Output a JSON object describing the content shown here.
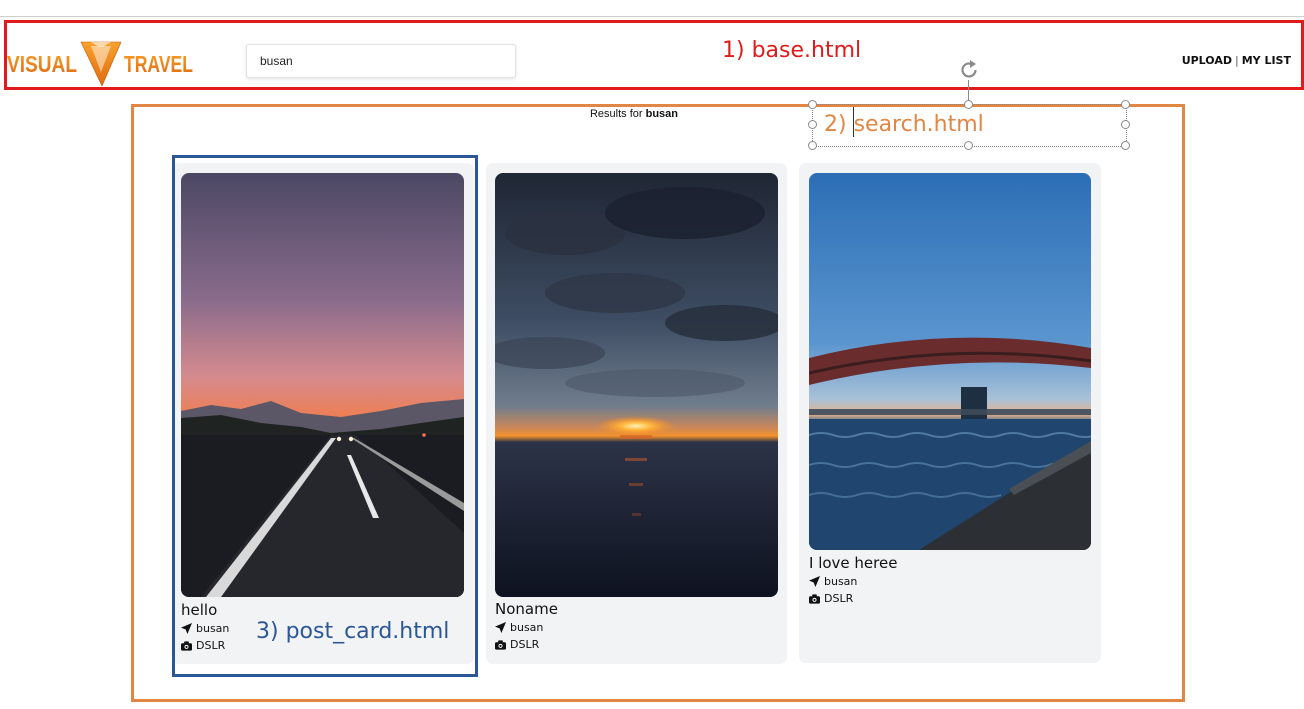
{
  "header": {
    "logo_left": "VISUAL",
    "logo_right": "TRAVEL",
    "search_value": "busan",
    "nav": {
      "upload": "UPLOAD",
      "separator": "|",
      "my_list": "MY LIST"
    }
  },
  "annotations": {
    "base": "1) base.html",
    "search": "2) search.html",
    "post_card": "3) post_card.html"
  },
  "results": {
    "prefix": "Results for",
    "query": "busan"
  },
  "posts": [
    {
      "title": "hello",
      "location": "busan",
      "camera": "DSLR"
    },
    {
      "title": "Noname",
      "location": "busan",
      "camera": "DSLR"
    },
    {
      "title": "I love heree",
      "location": "busan",
      "camera": "DSLR"
    }
  ],
  "colors": {
    "base_annotation": "#e01b1b",
    "search_annotation": "#e28743",
    "post_annotation": "#2b5797",
    "logo": "#f28a1a"
  }
}
